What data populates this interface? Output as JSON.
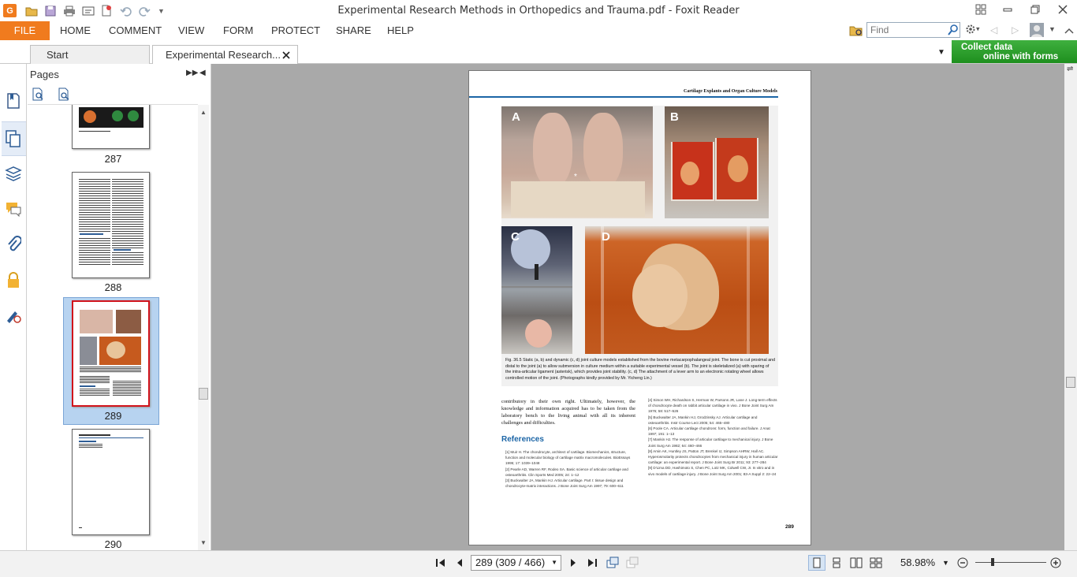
{
  "window": {
    "title": "Experimental Research Methods in Orthopedics and Trauma.pdf - Foxit Reader"
  },
  "ribbon": {
    "file": "FILE",
    "tabs": [
      "HOME",
      "COMMENT",
      "VIEW",
      "FORM",
      "PROTECT",
      "SHARE",
      "HELP"
    ],
    "find_placeholder": "Find"
  },
  "doc_tabs": {
    "start": "Start",
    "active": "Experimental Research..."
  },
  "promo": {
    "line1": "Collect data",
    "line2": "online with forms"
  },
  "pages_panel": {
    "title": "Pages",
    "thumbnails": [
      "287",
      "288",
      "289",
      "290"
    ],
    "selected": "289"
  },
  "document_page": {
    "running_head": "Cartilage Explants and Organ Culture Models",
    "panel_labels": [
      "A",
      "B",
      "C",
      "D"
    ],
    "figure_caption": "Fig. 36.5  Static (a, b) and dynamic (c, d) joint culture models established from the bovine metacarpophalangeal joint. The bone is cut proximal and distal to the joint (a) to allow submersion in culture medium within a suitable experimental vessel (b). The joint is skeletalized (a) with sparing of the intra-articular ligament (asterisk), which provides joint stability. (c, d) The attachment of a lever arm to an electronic rotating wheel allows controlled motion of the joint. (Photographs kindly provided by Mr. Yicheng Lin.)",
    "body_text": "contributory in their own right. Ultimately, however, the knowledge and information acquired has to be taken from the laboratory bench to the living animal with all its inherent challenges and difficulties.",
    "references_heading": "References",
    "references_left": [
      "[1]  Muir H. The chondrocyte, architect of cartilage. Biomechanics, structure, function and molecular biology of cartilage matrix macromolecules. BioEssays 1995; 17: 1039–1048",
      "[2]  Pearle AD, Warren RF, Rodeo SA. Basic science of articular cartilage and osteoarthritis. Clin Sports Med 2005; 24: 1–12",
      "[3]  Buckwalter JA, Mankin HJ. Articular cartilage. Part I: tissue design and chondrocyte-matrix interactions. J Bone Joint Surg Am 1997; 79: 600–611"
    ],
    "references_right": [
      "[4]  Simon WH, Richardson S, Herman W, Parsons JR, Lane J. Long-term effects of chondrocyte death on rabbit articular cartilage in vivo. J Bone Joint Surg Am 1976; 58: 517–526",
      "[5]  Buckwalter JA, Mankin HJ, Grodzinsky AJ. Articular cartilage and osteoarthritis. Instr Course Lect 2005; 54: 465–480",
      "[6]  Poole CA. Articular cartilage chondrons: form, function and failure. J Anat 1997; 191: 1–13",
      "[7]  Mankin HJ. The response of articular cartilage to mechanical injury. J Bone Joint Surg Am 1982; 64: 460–466",
      "[8]  Amin AK, Huntley JS, Patton JT, Brenkel IJ, Simpson AHRW, Hall AC. Hyperosmolarity protects chondrocytes from mechanical injury in human articular cartilage: an experimental report. J Bone Joint Surg Br 2011; 93: 277–284",
      "[9]  D'Lima DD, Hashimoto S, Chen PC, Lotz MK, Colwell CW, Jr. In vitro and in vivo models of cartilage injury. J Bone Joint Surg Am 2001; 83-A Suppl 2: 22–24"
    ],
    "page_number": "289"
  },
  "status_bar": {
    "page_field": "289 (309 / 466)",
    "zoom": "58.98%"
  }
}
